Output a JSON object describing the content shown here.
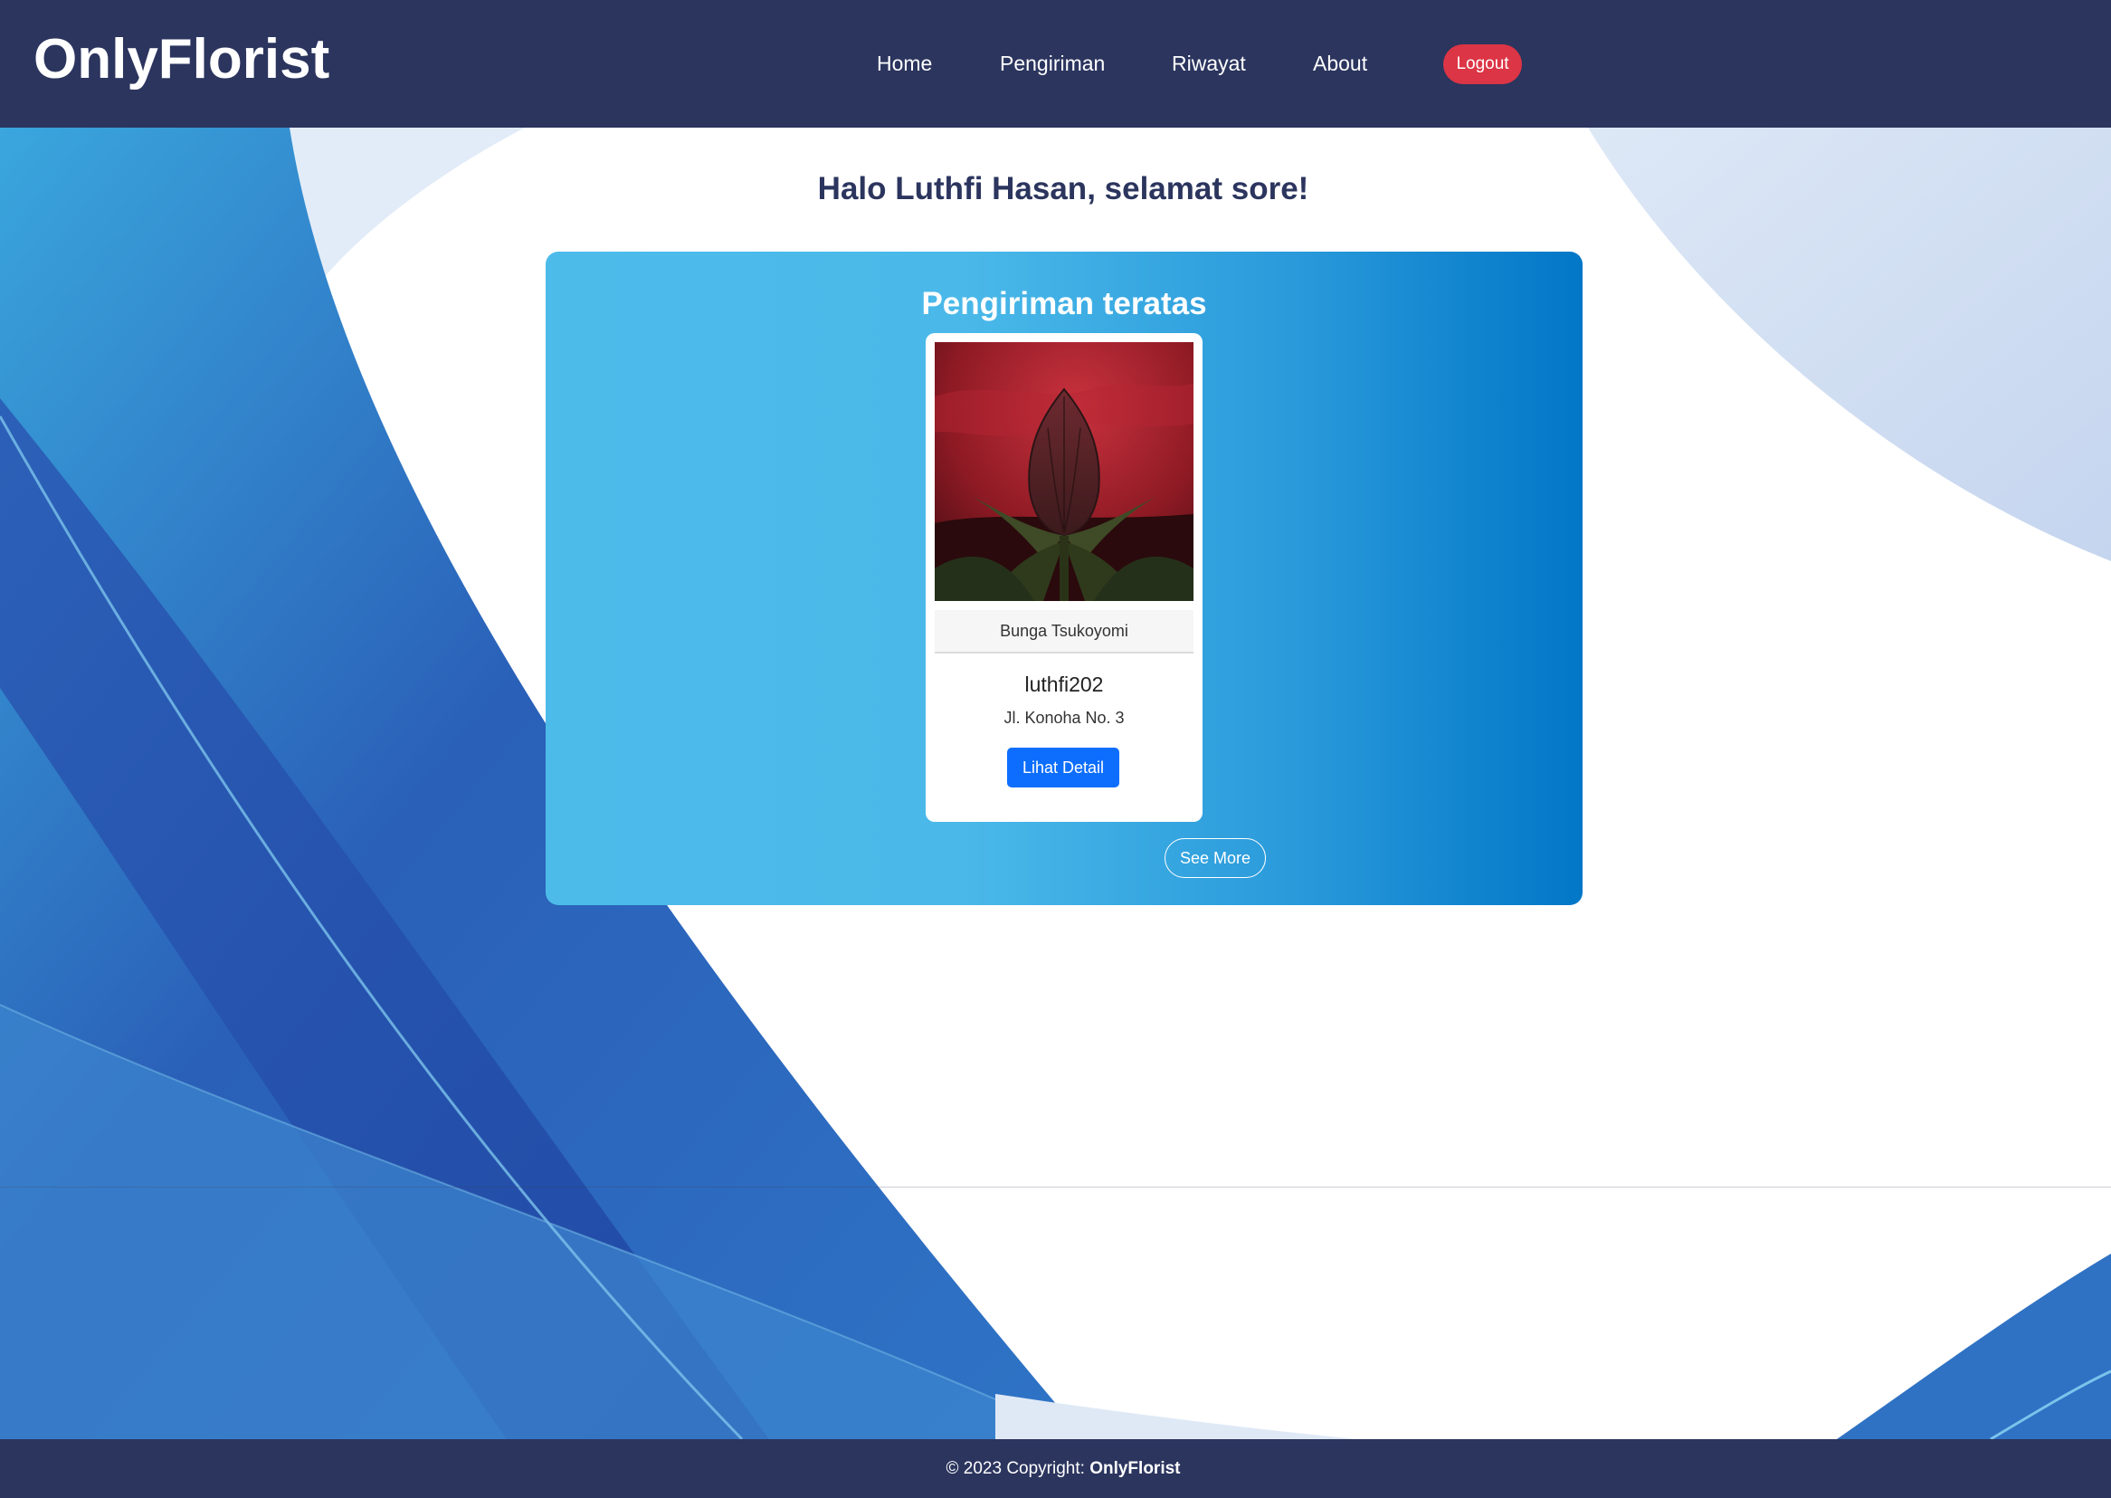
{
  "navbar": {
    "brand": "OnlyFlorist",
    "links": [
      "Home",
      "Pengiriman",
      "Riwayat",
      "About"
    ],
    "logout_label": "Logout"
  },
  "main": {
    "greeting": "Halo Luthfi Hasan, selamat sore!",
    "panel_title": "Pengiriman teratas",
    "card": {
      "caption": "Bunga Tsukoyomi",
      "username": "luthfi202",
      "address": "Jl. Konoha No. 3",
      "button_label": "Lihat Detail"
    },
    "see_more_label": "See More"
  },
  "footer": {
    "prefix": "© 2023 Copyright: ",
    "brand": "OnlyFlorist"
  },
  "colors": {
    "navbar": "#2b355e",
    "logout": "#dc3545",
    "primary_button": "#0d6efd",
    "panel_gradient_start": "#4dbbea",
    "panel_gradient_end": "#0277c7"
  }
}
